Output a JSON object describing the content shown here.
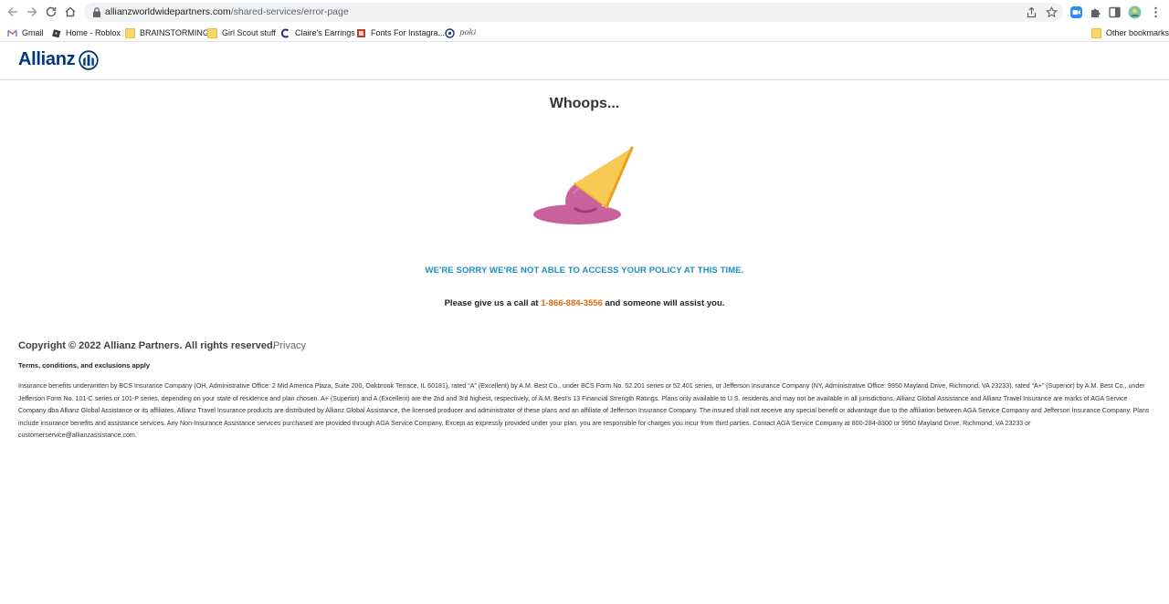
{
  "browser": {
    "url_host": "allianzworldwidepartners.com",
    "url_path": "/shared-services/error-page"
  },
  "bookmarks": [
    {
      "label": "Gmail",
      "icon": "gmail-icon"
    },
    {
      "label": "Home - Roblox",
      "icon": "roblox-icon"
    },
    {
      "label": "BRAINSTORMING",
      "icon": "docs-icon"
    },
    {
      "label": "Girl Scout stuff",
      "icon": "docs-icon"
    },
    {
      "label": "Claire's Earrings",
      "icon": "claires-icon"
    },
    {
      "label": "Fonts For Instagra...",
      "icon": "fonts-icon"
    },
    {
      "label": "poki",
      "icon": "poki-icon"
    },
    {
      "label": "Other bookmarks",
      "icon": "folder-icon"
    }
  ],
  "site": {
    "logo_text": "Allianz"
  },
  "main": {
    "heading": "Whoops...",
    "sorry_message": "WE'RE SORRY WE'RE NOT ABLE TO ACCESS YOUR POLICY AT THIS TIME.",
    "call_prefix": "Please give us a call at ",
    "phone": "1-866-884-3556",
    "call_suffix": " and someone will assist you."
  },
  "footer": {
    "copyright": "Copyright © 2022 Allianz Partners. All rights reserved.",
    "privacy": "Privacy",
    "terms": "Terms, conditions, and exclusions apply",
    "legal": "Insurance benefits underwritten by BCS Insurance Company (OH, Administrative Office: 2 Mid America Plaza, Suite 200, Oakbrook Terrace, IL 60181), rated “A” (Excellent) by A.M. Best Co., under BCS Form No. 52.201 series or 52.401 series, or Jefferson Insurance Company (NY, Administrative Office: 9950 Mayland Drive, Richmond, VA 23233), rated “A+” (Superior) by A.M. Best Co., under Jefferson Form No. 101-C series or 101-P series, depending on your state of residence and plan chosen. A+ (Superior) and A (Excellent) are the 2nd and 3rd highest, respectively, of A.M. Best's 13 Financial Strength Ratings. Plans only available to U.S. residents and may not be available in all jurisdictions. Allianz Global Assistance and Allianz Travel Insurance are marks of AGA Service Company dba Allianz Global Assistance or its affiliates. Allianz Travel Insurance products are distributed by Allianz Global Assistance, the licensed producer and administrator of these plans and an affiliate of Jefferson Insurance Company. The insured shall not receive any special benefit or advantage due to the affiliation between AGA Service Company and Jefferson Insurance Company. Plans include insurance benefits and assistance services. Any Non-Insurance Assistance services purchased are provided through AGA Service Company. Except as expressly provided under your plan, you are responsible for charges you incur from third parties. Contact AGA Service Company at 800-284-8300 or 9950 Mayland Drive, Richmond, VA 23233 or customerservice@allianzassistance.com."
  },
  "colors": {
    "brand_blue": "#003781",
    "link_blue": "#1e8fc6",
    "phone_orange": "#e06a0f",
    "ice_cream_pink": "#c9619d",
    "cone_yellow": "#f7ca55"
  }
}
